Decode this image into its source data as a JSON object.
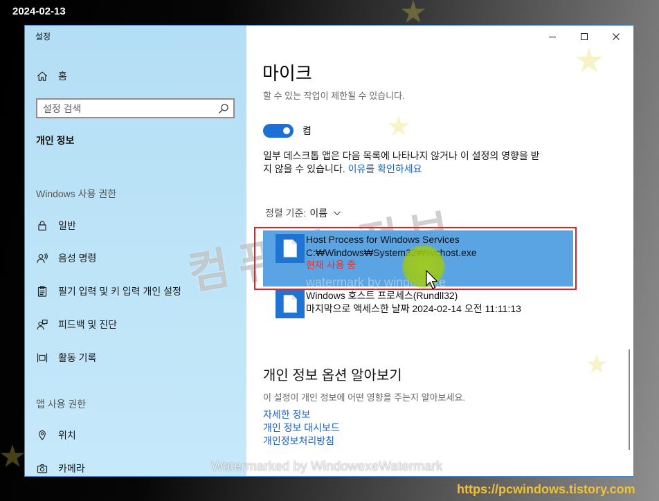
{
  "overlay": {
    "date": "2024-02-13",
    "site_url": "https://pcwindows.tistory.com",
    "watermark_big": "컴퓨터 정보",
    "watermark_item": "watermark by windowexe",
    "watermark_bottom": "Watermarked by WindowexeWatermark"
  },
  "window": {
    "title": "설정",
    "controls": [
      "minimize-icon",
      "maximize-icon",
      "close-icon"
    ]
  },
  "sidebar": {
    "home": {
      "label": "홈",
      "icon": "home-icon"
    },
    "search": {
      "placeholder": "설정 검색",
      "icon": "search-icon"
    },
    "section_title": "개인 정보",
    "groups": [
      {
        "header": "Windows 사용 권한",
        "items": [
          {
            "label": "일반",
            "icon": "lock-icon"
          },
          {
            "label": "음성 명령",
            "icon": "voice-icon"
          },
          {
            "label": "필기 입력 및 키 입력 개인 설정",
            "icon": "clipboard-icon"
          },
          {
            "label": "피드백 및 진단",
            "icon": "feedback-icon"
          },
          {
            "label": "활동 기록",
            "icon": "timeline-icon"
          }
        ]
      },
      {
        "header": "앱 사용 권한",
        "items": [
          {
            "label": "위치",
            "icon": "location-icon"
          },
          {
            "label": "카메라",
            "icon": "camera-icon"
          }
        ]
      }
    ]
  },
  "main": {
    "title": "마이크",
    "subtitle": "할 수 있는 작업이 제한될 수 있습니다.",
    "toggle": {
      "on": true,
      "label": "켬"
    },
    "notice": {
      "line1": "일부 데스크톱 앱은 다음 목록에 나타나지 않거나 이 설정의 영향을 받",
      "line2": "지 않을 수 있습니다.",
      "link": "이유를 확인하세요"
    },
    "sort": {
      "label": "정렬 기준:",
      "value": "이름",
      "icon": "chevron-down-icon"
    },
    "apps": [
      {
        "name": "Host Process for Windows Services",
        "path": "C:₩Windows₩System32₩svchost.exe",
        "status": "현재 사용 중",
        "selected": true,
        "icon": "document-icon"
      },
      {
        "name": "Windows 호스트 프로세스(Rundll32)",
        "status": "마지막으로 액세스한 날짜 2024-02-14 오전 11:11:13",
        "selected": false,
        "icon": "document-icon"
      }
    ],
    "learn_more": {
      "title": "개인 정보 옵션 알아보기",
      "description": "이 설정이 개인 정보에 어떤 영향을 주는지 알아보세요.",
      "links": [
        "자세한 정보",
        "개인 정보 대시보드",
        "개인정보처리방침"
      ]
    }
  },
  "colors": {
    "accent": "#1c6fd4",
    "link": "#1663c6",
    "selection": "#5aa4e4",
    "status_active": "#e8302b",
    "highlight_outline": "#d6262b",
    "site_url": "#f3c232",
    "sidebar_top": "#b4def5",
    "sidebar_bottom": "#c6e9fa"
  }
}
